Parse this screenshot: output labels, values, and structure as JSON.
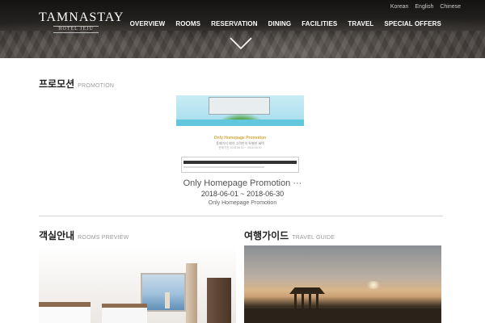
{
  "brand": {
    "name": "TAMNASTAY",
    "sub": "HOTEL JEJU"
  },
  "languages": [
    "Korean",
    "English",
    "Chinese"
  ],
  "nav": [
    "OVERVIEW",
    "ROOMS",
    "RESERVATION",
    "DINING",
    "FACILITIES",
    "TRAVEL",
    "SPECIAL OFFERS"
  ],
  "promotion": {
    "title_ko": "프로모션",
    "title_en": "PROMOTION",
    "image_title": "Only Homepage Promotion",
    "image_subtitle": "홈페이지 예약 고객만의 특별한 혜택",
    "image_period": "판매기간 2018.06.01 ~ 2018.06.30",
    "name": "Only Homepage Promotion ···",
    "dates": "2018-06-01 ~ 2018-06-30",
    "desc": "Only Homepage Promotion"
  },
  "rooms": {
    "title_ko": "객실안내",
    "title_en": "ROOMS PREVIEW"
  },
  "travel": {
    "title_ko": "여행가이드",
    "title_en": "TRAVEL GUIDE"
  }
}
